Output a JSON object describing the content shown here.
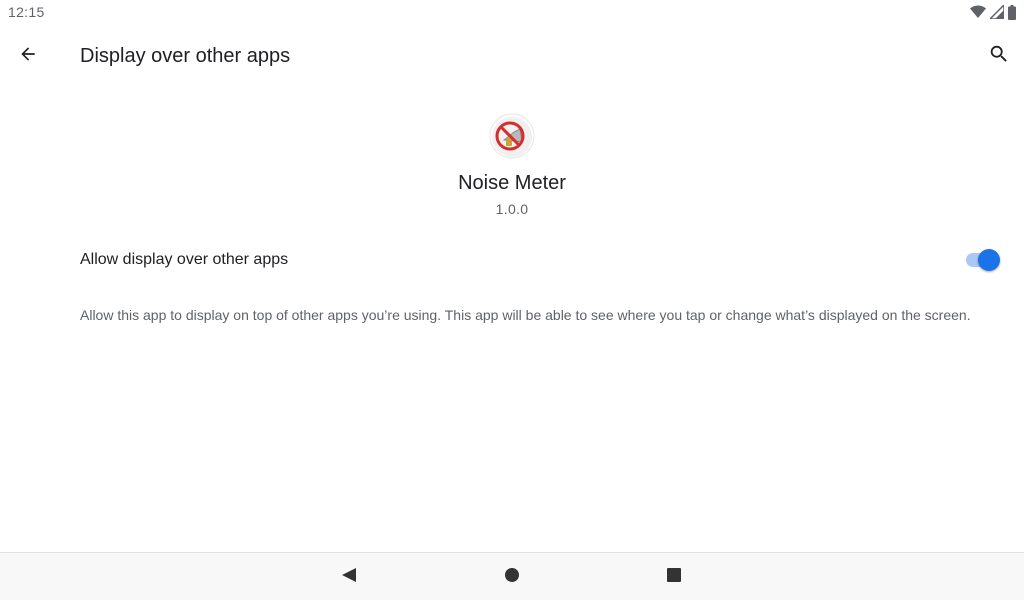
{
  "status_bar": {
    "time": "12:15",
    "icons": [
      "wifi-icon",
      "cell-signal-icon",
      "battery-icon"
    ]
  },
  "app_bar": {
    "title": "Display over other apps",
    "back_icon": "arrow-back-icon",
    "search_icon": "search-icon"
  },
  "app": {
    "name": "Noise Meter",
    "version": "1.0.0",
    "icon": "no-megaphone-icon"
  },
  "setting": {
    "label": "Allow display over other apps",
    "enabled": true
  },
  "description": "Allow this app to display on top of other apps you’re using. This app will be able to see where you tap or change what’s displayed on the screen.",
  "nav_bar": {
    "icons": [
      "nav-back-icon",
      "nav-home-icon",
      "nav-recents-icon"
    ]
  },
  "colors": {
    "accent": "#1a73e8",
    "track": "#a9c8f5",
    "text_primary": "#202124",
    "text_secondary": "#5f6368"
  }
}
